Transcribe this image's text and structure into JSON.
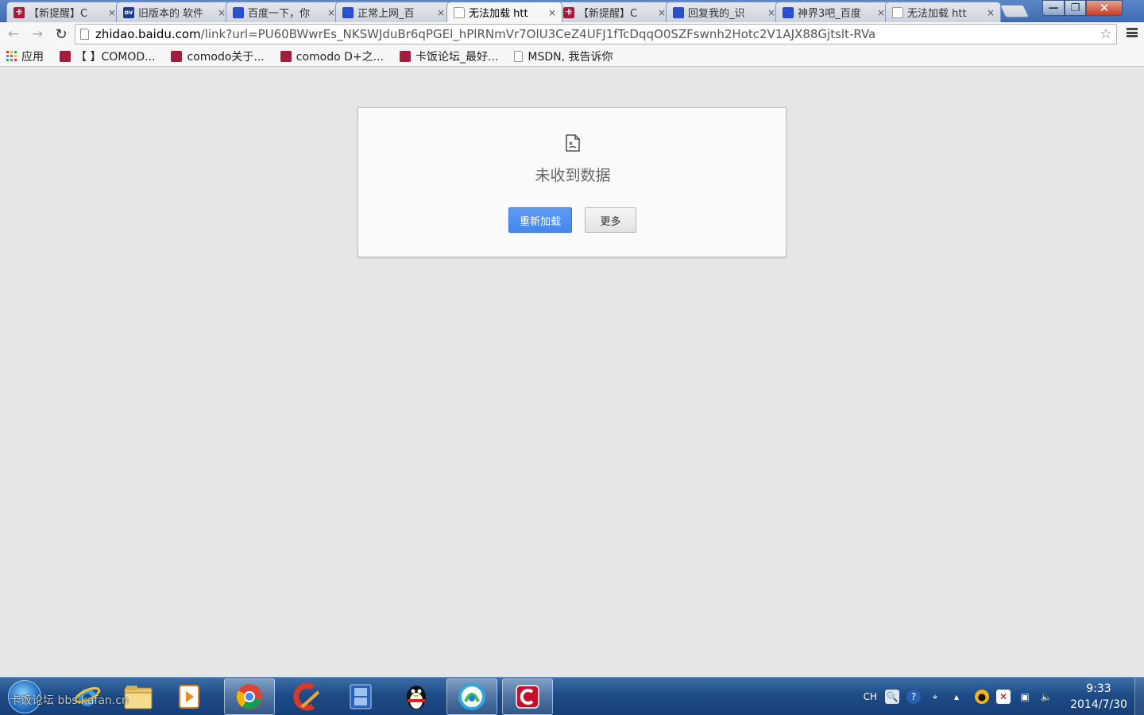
{
  "window": {
    "tabs": [
      {
        "favicon": "kafan-icon",
        "title": "【新提醒】C",
        "active": false
      },
      {
        "favicon": "ov-icon",
        "title": "旧版本的 软件",
        "active": false
      },
      {
        "favicon": "baidu-paw-icon",
        "title": "百度一下，你",
        "active": false
      },
      {
        "favicon": "baidu-paw-icon",
        "title": "正常上网_百",
        "active": false
      },
      {
        "favicon": "page-icon",
        "title": "无法加载 htt",
        "active": true
      },
      {
        "favicon": "kafan-icon",
        "title": "【新提醒】C",
        "active": false
      },
      {
        "favicon": "baidu-paw-icon",
        "title": "回复我的_识",
        "active": false
      },
      {
        "favicon": "baidu-paw-icon",
        "title": "神界3吧_百度",
        "active": false
      },
      {
        "favicon": "page-icon",
        "title": "无法加载 htt",
        "active": false
      }
    ],
    "close_glyph": "×",
    "min_glyph": "—",
    "max_glyph": "❐",
    "close_window_glyph": "✕"
  },
  "toolbar": {
    "back_glyph": "←",
    "forward_glyph": "→",
    "reload_glyph": "↻",
    "url_host": "zhidao.baidu.com",
    "url_path": "/link?url=PU60BWwrEs_NKSWJduBr6qPGEl_hPlRNmVr7OlU3CeZ4UFJ1fTcDqqO0SZFswnh2Hotc2V1AJX88Gjtslt-RVa",
    "star_glyph": "☆"
  },
  "bookmarks": [
    {
      "icon": "apps-icon",
      "label": "应用"
    },
    {
      "icon": "kafan-icon",
      "label": "【 】COMOD..."
    },
    {
      "icon": "kafan-icon",
      "label": "comodo关于..."
    },
    {
      "icon": "kafan-icon",
      "label": "comodo D+之..."
    },
    {
      "icon": "kafan-icon",
      "label": "卡饭论坛_最好..."
    },
    {
      "icon": "page-icon",
      "label": "MSDN, 我告诉你"
    }
  ],
  "error": {
    "icon": "broken-page-icon",
    "title": "未收到数据",
    "reload_label": "重新加载",
    "more_label": "更多"
  },
  "taskbar": {
    "watermark": "卡饭论坛 bbs.kafan.cn",
    "ime": "CH",
    "time": "9:33",
    "date": "2014/7/30",
    "colors": {
      "chrome": "#db4437",
      "ccleaner": "#d8382a",
      "qq": "#111111",
      "comodo": "#c8102e"
    }
  }
}
